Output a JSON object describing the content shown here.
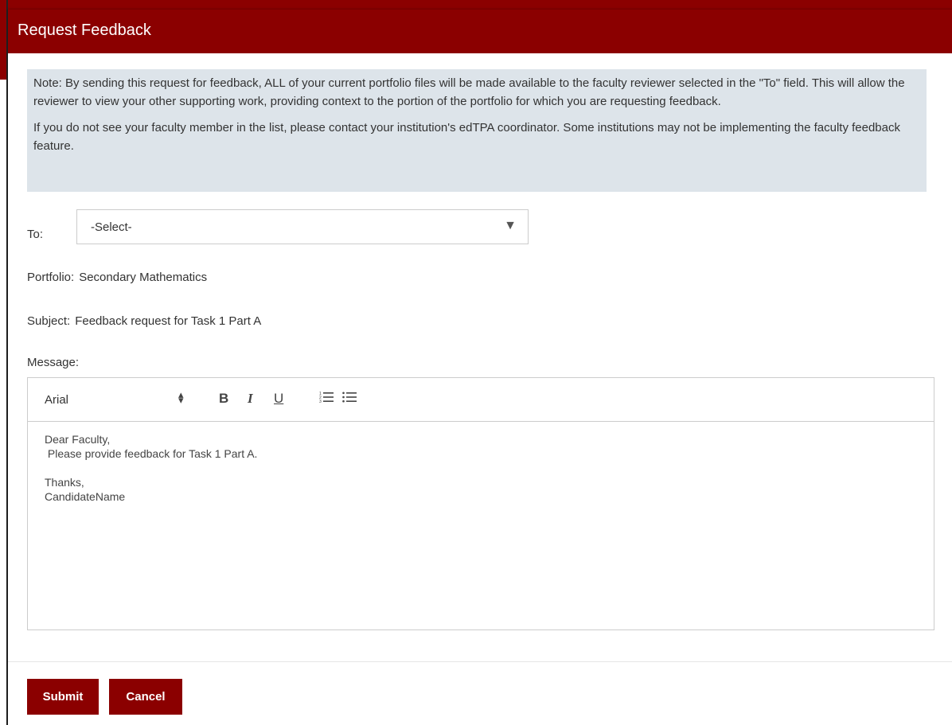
{
  "dialog": {
    "title": "Request Feedback",
    "note": {
      "paragraph1": "Note: By sending this request for feedback, ALL of your current portfolio files will be made available to the faculty reviewer selected in the \"To\" field. This will allow the reviewer to view your other supporting work, providing context to the portion of the portfolio for which you are requesting feedback.",
      "paragraph2": "If you do not see your faculty member in the list, please contact your institution's edTPA coordinator. Some institutions may not be implementing the faculty feedback feature."
    },
    "to": {
      "label": "To:",
      "value": "-Select-"
    },
    "portfolio": {
      "label": "Portfolio:",
      "value": "Secondary Mathematics"
    },
    "subject": {
      "label": "Subject:",
      "value": "Feedback request for Task 1 Part A"
    },
    "message": {
      "label": "Message:",
      "toolbar": {
        "font": "Arial",
        "bold": "B",
        "italic": "I",
        "underline": "U"
      },
      "lines": [
        "Dear Faculty,",
        " Please provide feedback for Task 1 Part A.",
        "",
        "Thanks,",
        "CandidateName"
      ]
    },
    "buttons": {
      "submit": "Submit",
      "cancel": "Cancel"
    }
  },
  "colors": {
    "primary": "#8b0000",
    "note_background": "#dde4ea"
  },
  "icons": {
    "select_arrow": "triangle-down-icon",
    "font_arrows": "up-down-arrows-icon",
    "ordered_list": "ordered-list-icon",
    "bullet_list": "bullet-list-icon"
  }
}
